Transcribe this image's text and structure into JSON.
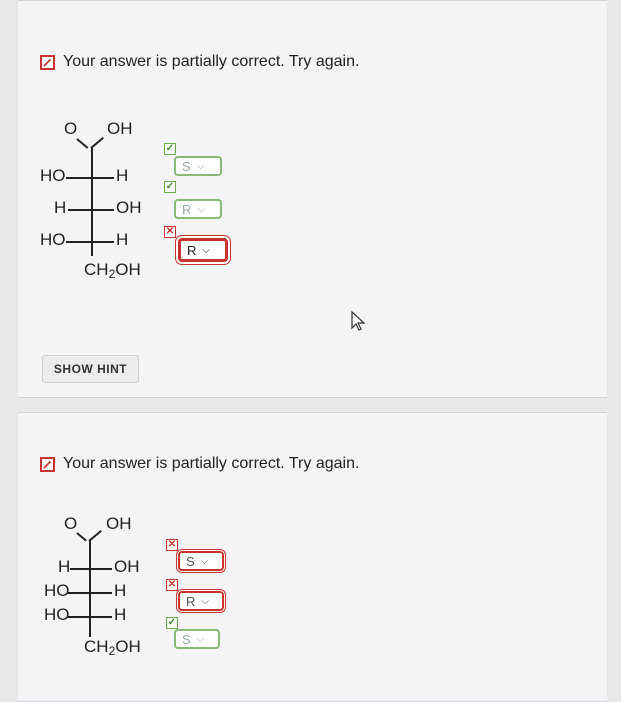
{
  "q1": {
    "status_text": "Your answer is partially correct.  Try again.",
    "molecule": {
      "top_o": "O",
      "top_oh": "OH",
      "rows": [
        {
          "left": "HO",
          "right": "H"
        },
        {
          "left": "H",
          "right": "OH"
        },
        {
          "left": "HO",
          "right": "H"
        }
      ],
      "bottom": "CH",
      "bottom_sub": "2",
      "bottom_tail": "OH"
    },
    "answers": [
      {
        "value": "S",
        "mark": "✓",
        "result": "correct"
      },
      {
        "value": "R",
        "mark": "✓",
        "result": "correct"
      },
      {
        "value": "R",
        "mark": "✕",
        "result": "incorrect"
      }
    ],
    "hint_button": "SHOW HINT"
  },
  "q2": {
    "status_text": "Your answer is partially correct.  Try again.",
    "molecule": {
      "top_o": "O",
      "top_oh": "OH",
      "rows": [
        {
          "left": "H",
          "right": "OH"
        },
        {
          "left": "HO",
          "right": "H"
        },
        {
          "left": "HO",
          "right": "H"
        }
      ],
      "bottom": "CH",
      "bottom_sub": "2",
      "bottom_tail": "OH"
    },
    "answers": [
      {
        "value": "S",
        "mark": "✕",
        "result": "incorrect"
      },
      {
        "value": "R",
        "mark": "✕",
        "result": "incorrect"
      },
      {
        "value": "S",
        "mark": "✓",
        "result": "correct"
      }
    ]
  },
  "colors": {
    "error": "#c8332f",
    "correct": "#6aa84f"
  },
  "icons": {
    "status": "pencil-icon",
    "cursor": "mouse-pointer-icon",
    "dropdown": "chevron-down-icon"
  }
}
